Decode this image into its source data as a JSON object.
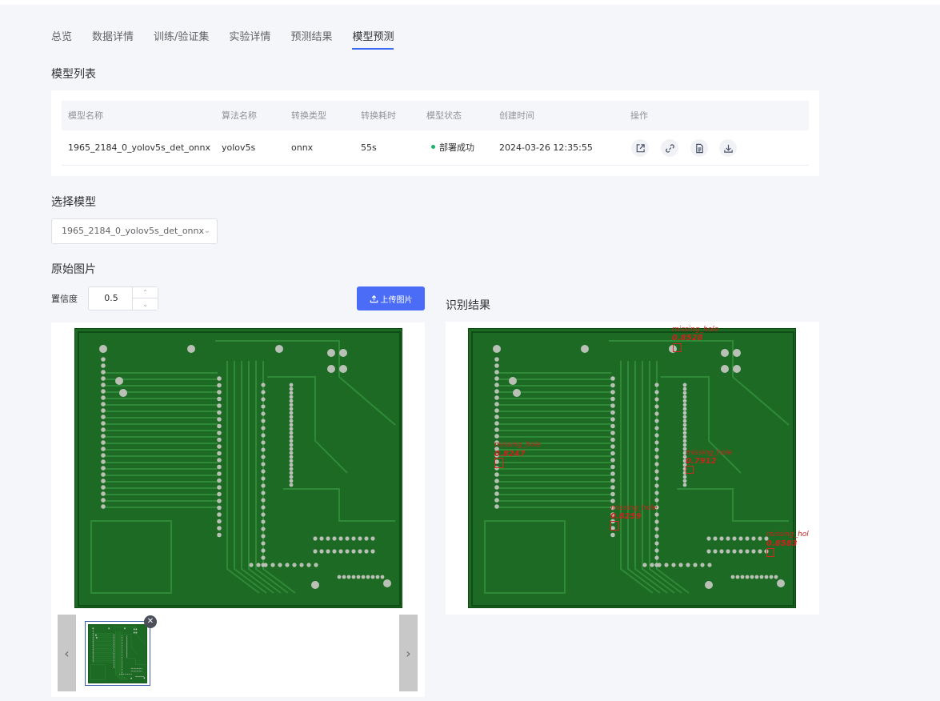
{
  "tabs": [
    {
      "label": "总览",
      "active": false
    },
    {
      "label": "数据详情",
      "active": false
    },
    {
      "label": "训练/验证集",
      "active": false
    },
    {
      "label": "实验详情",
      "active": false
    },
    {
      "label": "预测结果",
      "active": false
    },
    {
      "label": "模型预测",
      "active": true
    }
  ],
  "model_list": {
    "title": "模型列表",
    "columns": [
      "模型名称",
      "算法名称",
      "转换类型",
      "转换耗时",
      "模型状态",
      "创建时间",
      "操作"
    ],
    "rows": [
      {
        "name": "1965_2184_0_yolov5s_det_onnx",
        "algorithm": "yolov5s",
        "convert_type": "onnx",
        "convert_time": "55s",
        "status": "部署成功",
        "created": "2024-03-26 12:35:55",
        "actions": [
          "share-icon",
          "link-icon",
          "document-icon",
          "download-icon"
        ]
      }
    ]
  },
  "select_model": {
    "title": "选择模型",
    "value": "1965_2184_0_yolov5s_det_onnx"
  },
  "original": {
    "title": "原始图片",
    "confidence_label": "置信度",
    "confidence_value": "0.5",
    "upload_label": "上传图片"
  },
  "result": {
    "title": "识别结果",
    "detections": [
      {
        "label": "missing_hole",
        "score": "0.8528"
      },
      {
        "label": "missing_hole",
        "score": "0.8247"
      },
      {
        "label": "missing_hole",
        "score": "0.7912"
      },
      {
        "label": "missing_hole",
        "score": "0.8259"
      },
      {
        "label": "missing_hol",
        "score": "0.8583"
      }
    ]
  },
  "colors": {
    "accent": "#4a6cf7",
    "success": "#19b36b",
    "pcb_green": "#1d6a24",
    "detection_red": "#c8241c"
  }
}
